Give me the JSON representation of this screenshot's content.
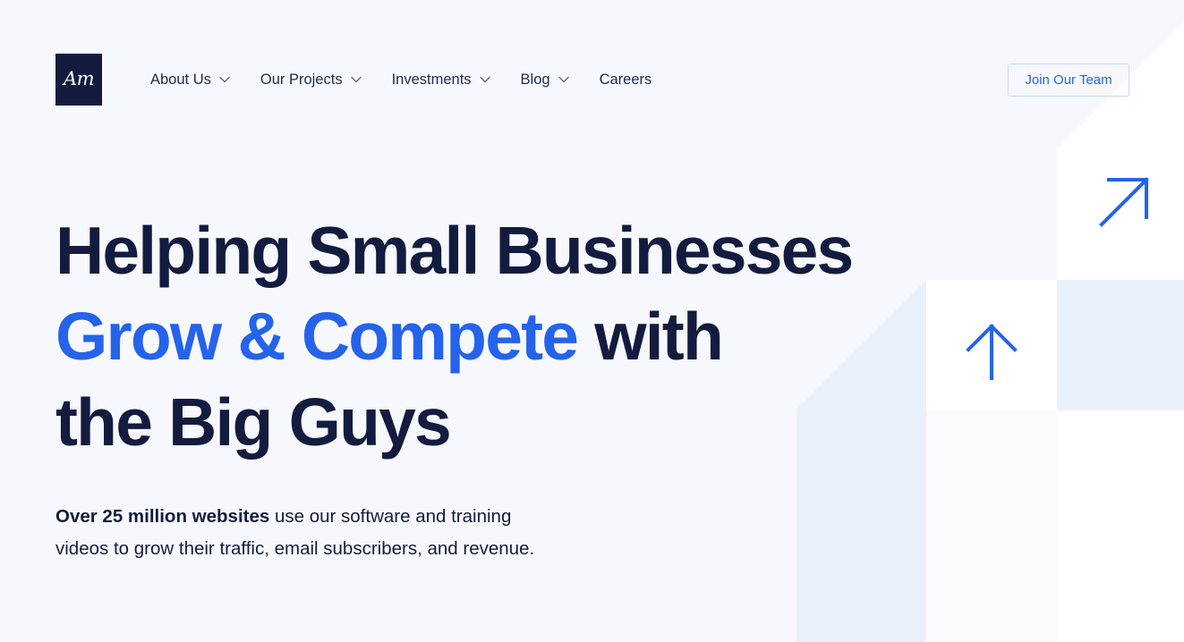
{
  "theme": {
    "background": "#F7F8FD",
    "navy": "#131C3F",
    "accent_blue": "#2563EB",
    "tile_lavender": "#EAF0FB",
    "tile_white": "#FFFFFF",
    "tile_faint": "#FAFBFE",
    "cta_border": "#C5D6F5"
  },
  "header": {
    "logo": {
      "text": "Am",
      "icon": "logo-monogram"
    },
    "nav": [
      {
        "label": "About Us",
        "has_dropdown": true,
        "icon": "chevron-down-icon"
      },
      {
        "label": "Our Projects",
        "has_dropdown": true,
        "icon": "chevron-down-icon"
      },
      {
        "label": "Investments",
        "has_dropdown": true,
        "icon": "chevron-down-icon"
      },
      {
        "label": "Blog",
        "has_dropdown": true,
        "icon": "chevron-down-icon"
      },
      {
        "label": "Careers",
        "has_dropdown": false,
        "icon": ""
      }
    ],
    "cta": {
      "label": "Join Our Team"
    }
  },
  "hero": {
    "headline": {
      "line1": "Helping Small Businesses",
      "line2_accent": "Grow & Compete",
      "line2_rest": " with",
      "line3": "the Big Guys"
    },
    "subcopy": {
      "bold": "Over 25 million websites",
      "rest": " use our software and training videos to grow their traffic, email subscribers, and revenue."
    }
  },
  "decoration": {
    "arrows": [
      {
        "name": "arrow-up-right-icon",
        "color": "#2563EB"
      },
      {
        "name": "arrow-up-icon",
        "color": "#2563EB"
      }
    ]
  }
}
